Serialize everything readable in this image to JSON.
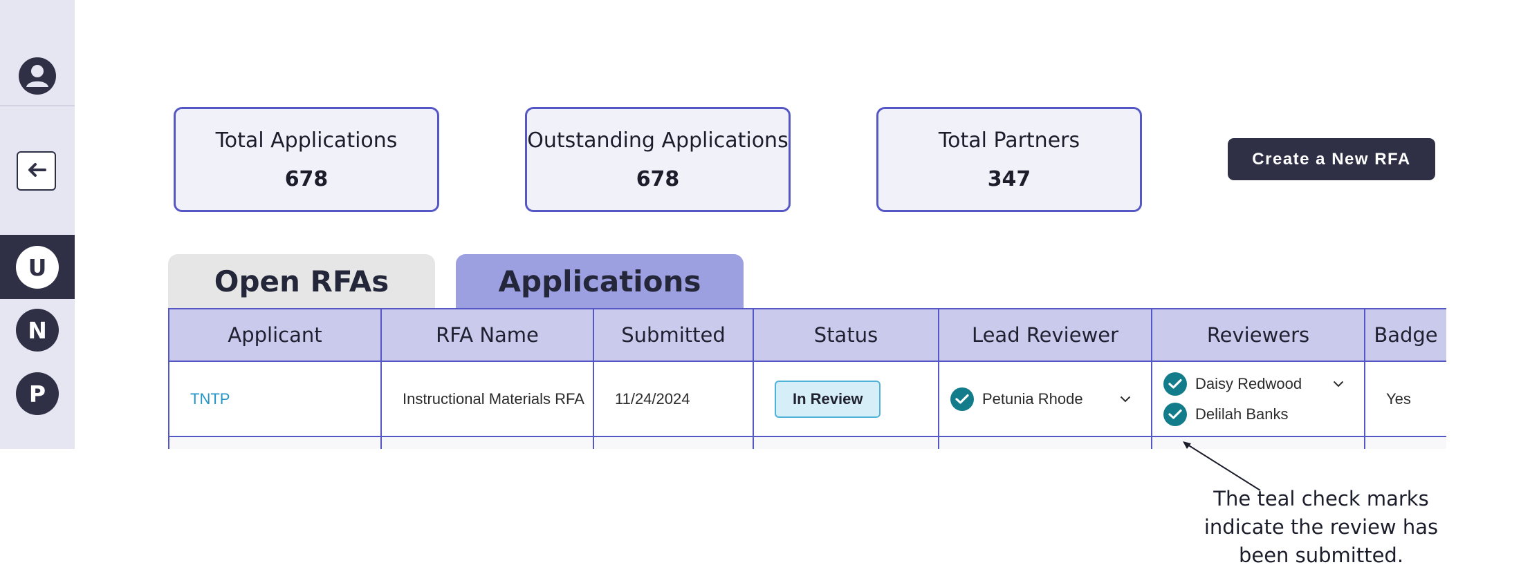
{
  "sidebar": {
    "profile_icon": "user-circle-icon",
    "back_icon": "arrow-left-icon",
    "users": [
      {
        "letter": "U",
        "active": true
      },
      {
        "letter": "N",
        "active": false
      },
      {
        "letter": "P",
        "active": false
      }
    ]
  },
  "stats": [
    {
      "label": "Total Applications",
      "value": "678"
    },
    {
      "label": "Outstanding Applications",
      "value": "678"
    },
    {
      "label": "Total Partners",
      "value": "347"
    }
  ],
  "create_button": {
    "label": "Create a New RFA"
  },
  "tabs": [
    {
      "label": "Open RFAs",
      "active": false
    },
    {
      "label": "Applications",
      "active": true
    }
  ],
  "table": {
    "columns": [
      "Applicant",
      "RFA Name",
      "Submitted",
      "Status",
      "Lead Reviewer",
      "Reviewers",
      "Badge"
    ],
    "rows": [
      {
        "applicant": "TNTP",
        "rfa_name": "Instructional Materials RFA",
        "submitted": "11/24/2024",
        "status": "In Review",
        "lead_reviewer": "Petunia Rhode",
        "reviewers": [
          "Daisy Redwood",
          "Delilah Banks"
        ],
        "badge": "Yes"
      }
    ]
  },
  "annotation": {
    "text": "The teal check marks indicate the review has been submitted."
  },
  "colors": {
    "accent": "#5558c4",
    "header_bg": "#c9caec",
    "active_tab": "#9c9fe0",
    "teal_check": "#137c8a",
    "dark": "#2f3045",
    "link": "#2596c8"
  }
}
